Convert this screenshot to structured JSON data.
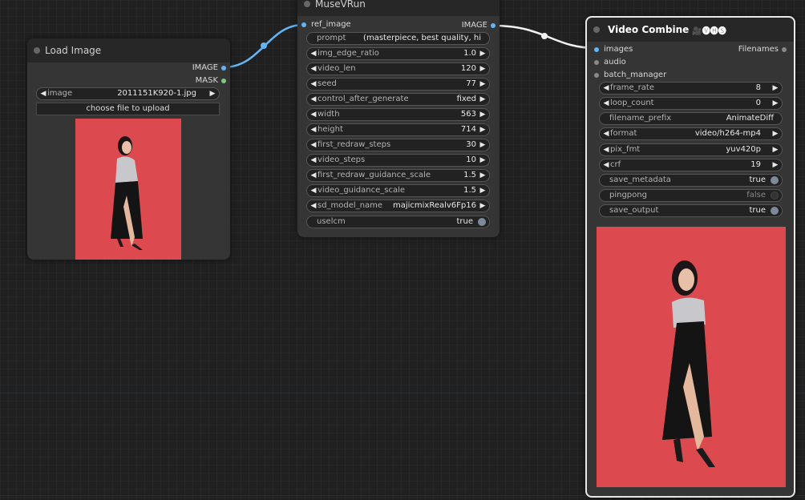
{
  "load_image": {
    "title": "Load Image",
    "outputs": [
      {
        "label": "IMAGE",
        "color": "#64b5f6"
      },
      {
        "label": "MASK",
        "color": "#81c784"
      }
    ],
    "image_widget": {
      "label": "image",
      "value": "2011151K920-1.jpg"
    },
    "upload_label": "choose file to upload"
  },
  "musev": {
    "title": "MuseVRun",
    "input": {
      "label": "ref_image",
      "color": "#64b5f6"
    },
    "output": {
      "label": "IMAGE",
      "color": "#64b5f6"
    },
    "prompt": {
      "label": "prompt",
      "value": "(masterpiece, best quality, hi"
    },
    "widgets": [
      {
        "label": "img_edge_ratio",
        "value": "1.0"
      },
      {
        "label": "video_len",
        "value": "120"
      },
      {
        "label": "seed",
        "value": "77"
      },
      {
        "label": "control_after_generate",
        "value": "fixed"
      },
      {
        "label": "width",
        "value": "563"
      },
      {
        "label": "height",
        "value": "714"
      },
      {
        "label": "first_redraw_steps",
        "value": "30"
      },
      {
        "label": "video_steps",
        "value": "10"
      },
      {
        "label": "first_redraw_guidance_scale",
        "value": "1.5"
      },
      {
        "label": "video_guidance_scale",
        "value": "1.5"
      },
      {
        "label": "sd_model_name",
        "value": "majicmixRealv6Fp16"
      }
    ],
    "toggle": {
      "label": "uselcm",
      "value": "true"
    }
  },
  "video_combine": {
    "title": "Video Combine",
    "title_icons": "🎥🅥🅗🅢",
    "inputs": [
      {
        "label": "images",
        "color": "#64b5f6"
      },
      {
        "label": "audio",
        "color": "#888888"
      },
      {
        "label": "batch_manager",
        "color": "#888888"
      }
    ],
    "output": {
      "label": "Filenames",
      "color": "#888888"
    },
    "frame_rate": {
      "label": "frame_rate",
      "value": "8"
    },
    "loop_count": {
      "label": "loop_count",
      "value": "0"
    },
    "filename_prefix": {
      "label": "filename_prefix",
      "value": "AnimateDiff"
    },
    "format": {
      "label": "format",
      "value": "video/h264-mp4"
    },
    "pix_fmt": {
      "label": "pix_fmt",
      "value": "yuv420p"
    },
    "crf": {
      "label": "crf",
      "value": "19"
    },
    "save_metadata": {
      "label": "save_metadata",
      "value": "true"
    },
    "pingpong": {
      "label": "pingpong",
      "value": "false"
    },
    "save_output": {
      "label": "save_output",
      "value": "true"
    }
  },
  "icons": {
    "left_arrow": "◀",
    "right_arrow": "▶"
  },
  "colors": {
    "image_link": "#64b5f6",
    "output_link": "#ffffff",
    "photo_bg": "#d9454b"
  }
}
